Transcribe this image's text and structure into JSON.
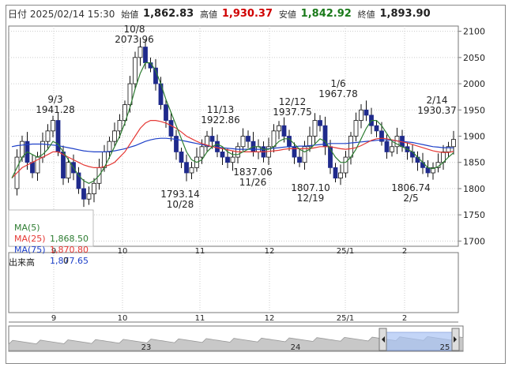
{
  "header": {
    "datetime": "日付 2025/02/14 15:30",
    "open_label": "始値",
    "open_value": "1,862.83",
    "high_label": "高値",
    "high_value": "1,930.37",
    "low_label": "安値",
    "low_value": "1,842.92",
    "close_label": "終値",
    "close_value": "1,893.90"
  },
  "colors": {
    "up": "#ffffff",
    "down": "#1f2a8c",
    "ma5": "#2e7d32",
    "ma25": "#e53935",
    "ma75": "#1e40c8",
    "high_text": "#d00000",
    "low_text": "#1a7a1a"
  },
  "legend": [
    {
      "name": "MA(5)",
      "value": "1,868.50",
      "color": "#2e7d32"
    },
    {
      "name": "MA(25)",
      "value": "1,870.80",
      "color": "#e53935"
    },
    {
      "name": "MA(75)",
      "value": "1,877.65",
      "color": "#1e40c8"
    }
  ],
  "volume": {
    "label": "出来高",
    "value": "0"
  },
  "chart_data": {
    "type": "candlestick",
    "title": "",
    "ylim": [
      1690,
      2110
    ],
    "y_ticks": [
      1700,
      1750,
      1800,
      1850,
      1900,
      1950,
      2000,
      2050,
      2100
    ],
    "x_tick_labels": [
      "9",
      "10",
      "11",
      "12",
      "25/1",
      "2"
    ],
    "navigator_labels": [
      "23",
      "24",
      "25"
    ],
    "annotations": [
      {
        "date": "9/3",
        "value": "1941.28",
        "kind": "high"
      },
      {
        "date": "10/8",
        "value": "2073.96",
        "kind": "high"
      },
      {
        "date": "11/13",
        "value": "1922.86",
        "kind": "high"
      },
      {
        "date": "12/12",
        "value": "1937.75",
        "kind": "high"
      },
      {
        "date": "1/6",
        "value": "1967.78",
        "kind": "high"
      },
      {
        "date": "2/14",
        "value": "1930.37",
        "kind": "high"
      },
      {
        "date": "10/28",
        "value": "1793.14",
        "kind": "low"
      },
      {
        "date": "11/26",
        "value": "1837.06",
        "kind": "low"
      },
      {
        "date": "12/19",
        "value": "1807.10",
        "kind": "low"
      },
      {
        "date": "2/5",
        "value": "1806.74",
        "kind": "low"
      }
    ],
    "close_series": [
      1800,
      1860,
      1890,
      1850,
      1830,
      1860,
      1890,
      1910,
      1930,
      1870,
      1820,
      1850,
      1830,
      1800,
      1780,
      1790,
      1810,
      1840,
      1870,
      1890,
      1910,
      1930,
      1960,
      2000,
      2050,
      2070,
      2040,
      2030,
      2000,
      1960,
      1930,
      1900,
      1870,
      1850,
      1830,
      1840,
      1860,
      1880,
      1900,
      1890,
      1870,
      1860,
      1850,
      1860,
      1880,
      1900,
      1890,
      1870,
      1880,
      1860,
      1880,
      1910,
      1920,
      1900,
      1880,
      1860,
      1850,
      1880,
      1900,
      1930,
      1920,
      1880,
      1840,
      1820,
      1830,
      1860,
      1900,
      1930,
      1950,
      1940,
      1920,
      1910,
      1890,
      1870,
      1880,
      1900,
      1880,
      1870,
      1860,
      1850,
      1840,
      1830,
      1840,
      1850,
      1870,
      1880,
      1893.9
    ],
    "ma5": [
      1820,
      1840,
      1860,
      1870,
      1865,
      1860,
      1865,
      1875,
      1890,
      1885,
      1870,
      1855,
      1840,
      1825,
      1815,
      1810,
      1815,
      1825,
      1840,
      1860,
      1880,
      1900,
      1925,
      1955,
      1990,
      2020,
      2040,
      2040,
      2025,
      2000,
      1970,
      1945,
      1920,
      1895,
      1870,
      1855,
      1850,
      1855,
      1870,
      1880,
      1885,
      1880,
      1870,
      1865,
      1865,
      1870,
      1875,
      1880,
      1880,
      1875,
      1875,
      1880,
      1890,
      1895,
      1895,
      1885,
      1875,
      1870,
      1875,
      1885,
      1895,
      1890,
      1875,
      1860,
      1850,
      1850,
      1860,
      1875,
      1895,
      1915,
      1930,
      1930,
      1920,
      1905,
      1890,
      1885,
      1880,
      1875,
      1870,
      1860,
      1850,
      1840,
      1838,
      1842,
      1850,
      1860,
      1868.5
    ],
    "ma25": [
      1820,
      1830,
      1840,
      1845,
      1850,
      1855,
      1860,
      1865,
      1870,
      1870,
      1865,
      1860,
      1855,
      1850,
      1845,
      1842,
      1840,
      1840,
      1842,
      1845,
      1850,
      1860,
      1870,
      1885,
      1900,
      1915,
      1925,
      1930,
      1930,
      1928,
      1925,
      1920,
      1915,
      1908,
      1900,
      1895,
      1890,
      1886,
      1883,
      1880,
      1878,
      1876,
      1874,
      1872,
      1870,
      1870,
      1870,
      1870,
      1870,
      1870,
      1871,
      1872,
      1873,
      1875,
      1876,
      1876,
      1876,
      1876,
      1876,
      1878,
      1880,
      1880,
      1880,
      1878,
      1876,
      1875,
      1876,
      1878,
      1882,
      1887,
      1892,
      1895,
      1896,
      1895,
      1893,
      1891,
      1889,
      1887,
      1884,
      1881,
      1878,
      1875,
      1872,
      1870,
      1869,
      1869,
      1870.8
    ],
    "ma75": [
      1880,
      1882,
      1883,
      1884,
      1885,
      1885,
      1885,
      1884,
      1883,
      1882,
      1880,
      1878,
      1876,
      1874,
      1872,
      1871,
      1870,
      1870,
      1870,
      1871,
      1872,
      1874,
      1876,
      1879,
      1882,
      1886,
      1890,
      1893,
      1895,
      1896,
      1896,
      1895,
      1894,
      1892,
      1890,
      1888,
      1886,
      1884,
      1882,
      1880,
      1879,
      1878,
      1877,
      1876,
      1875,
      1875,
      1875,
      1875,
      1875,
      1875,
      1876,
      1877,
      1878,
      1879,
      1880,
      1880,
      1881,
      1881,
      1882,
      1883,
      1884,
      1885,
      1886,
      1886,
      1886,
      1886,
      1887,
      1888,
      1889,
      1890,
      1891,
      1892,
      1893,
      1893,
      1892,
      1891,
      1890,
      1889,
      1888,
      1886,
      1884,
      1882,
      1880,
      1879,
      1878,
      1878,
      1877.65
    ]
  }
}
